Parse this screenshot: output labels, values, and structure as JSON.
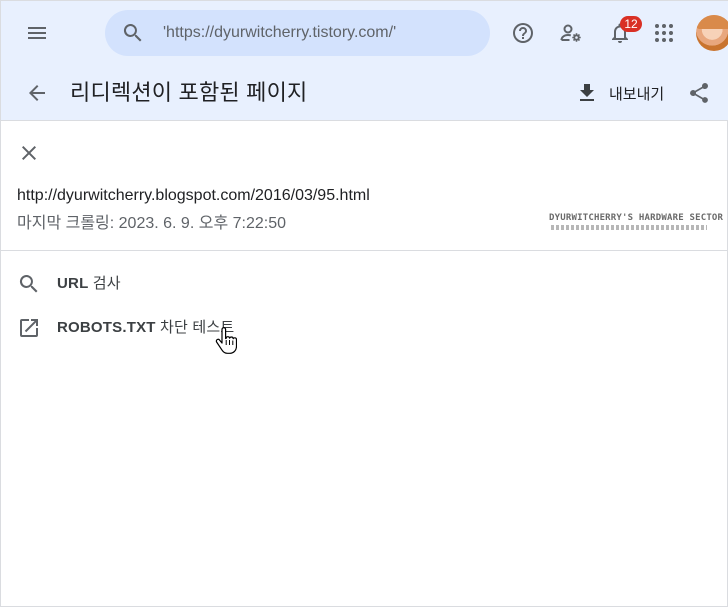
{
  "topbar": {
    "search_placeholder": "'https://dyurwitcherry.tistory.com/'",
    "notification_count": "12",
    "icons": [
      "menu-icon",
      "search-icon",
      "help-icon",
      "manage-users-icon",
      "notifications-icon",
      "apps-grid-icon"
    ]
  },
  "header": {
    "title": "리디렉션이 포함된 페이지",
    "export_label": "내보내기",
    "icons": [
      "back-arrow-icon",
      "download-icon",
      "share-icon"
    ]
  },
  "detail": {
    "url": "http://dyurwitcherry.blogspot.com/2016/03/95.html",
    "last_crawled": "마지막 크롤링: 2023. 6. 9. 오후 7:22:50",
    "thumbnail_text": "DYURWITCHERRY'S HARDWARE SECTOR"
  },
  "actions": [
    {
      "label_bold": "URL",
      "label_rest": " 검사",
      "icon": "search-icon"
    },
    {
      "label_bold": "ROBOTS.TXT",
      "label_rest": " 차단 테스트",
      "icon": "open-in-new-icon"
    }
  ],
  "colors": {
    "header_bg": "#e8f0fe",
    "search_bg": "#d3e2fd",
    "badge": "#d93025",
    "text_primary": "#202124",
    "text_secondary": "#5f6368"
  }
}
